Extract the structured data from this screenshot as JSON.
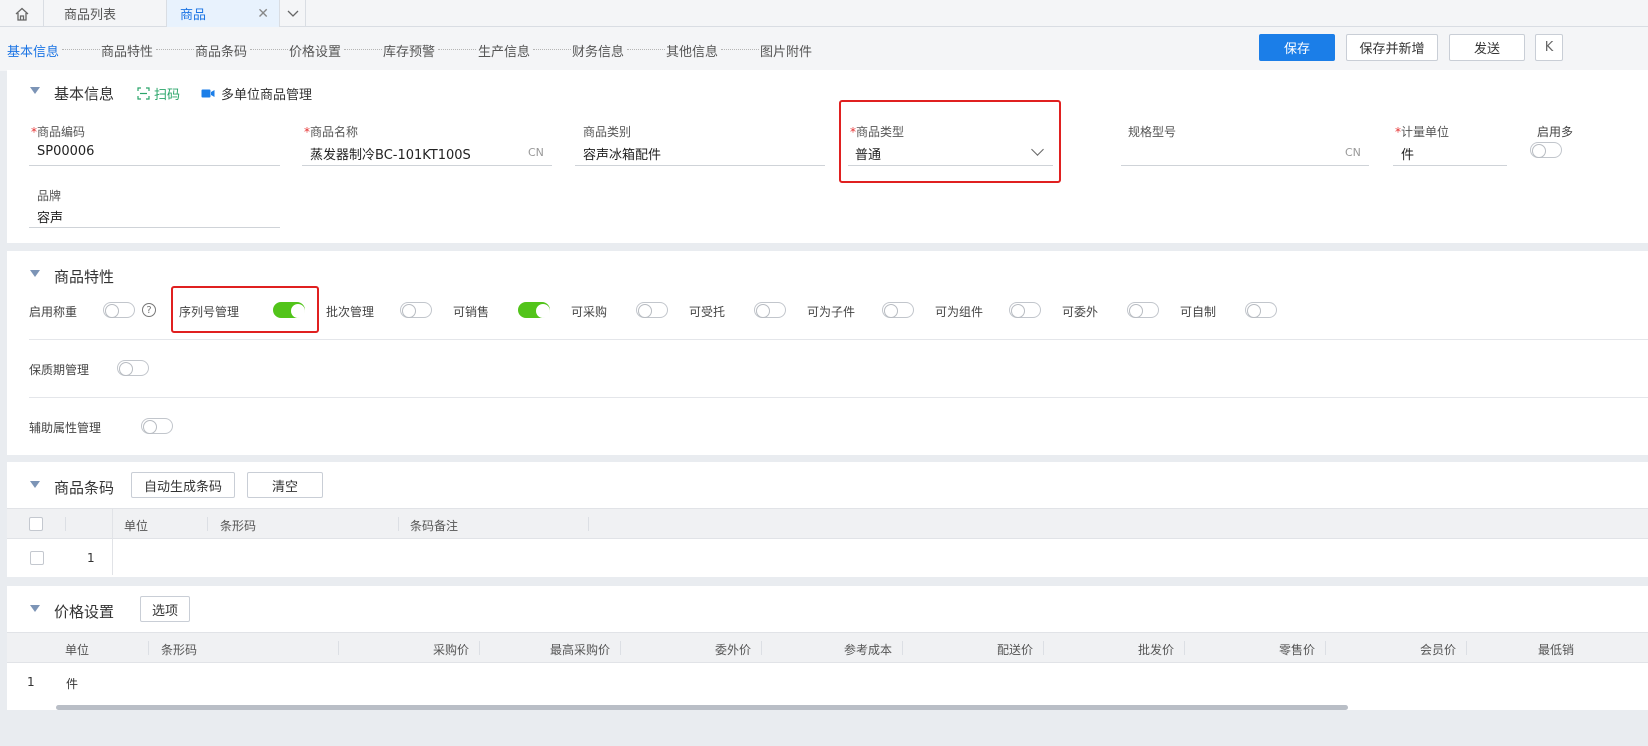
{
  "top_tabs": {
    "home_icon": "home-icon",
    "tabs": [
      {
        "label": "商品列表"
      },
      {
        "label": "商品"
      }
    ],
    "close_icon": "close-icon",
    "more_icon": "chevron-down-icon"
  },
  "anchors": [
    "基本信息",
    "商品特性",
    "商品条码",
    "价格设置",
    "库存预警",
    "生产信息",
    "财务信息",
    "其他信息",
    "图片附件"
  ],
  "toolbar": {
    "save": "保存",
    "save_and_new": "保存并新增",
    "send": "发送",
    "collapse": "K"
  },
  "basic_info": {
    "title": "基本信息",
    "scan_label": "扫码",
    "multi_unit_label": "多单位商品管理",
    "fields": {
      "code": {
        "label": "商品编码",
        "value": "SP00006",
        "required": "*"
      },
      "name": {
        "label": "商品名称",
        "value": "蒸发器制冷BC-101KT100S",
        "suffix": "CN",
        "required": "*"
      },
      "category": {
        "label": "商品类别",
        "value": "容声冰箱配件"
      },
      "type": {
        "label": "商品类型",
        "value": "普通",
        "required": "*"
      },
      "spec": {
        "label": "规格型号",
        "value": "",
        "suffix": "CN"
      },
      "unit": {
        "label": "计量单位",
        "value": "件",
        "required": "*"
      },
      "multi_unit": {
        "label": "启用多"
      },
      "brand": {
        "label": "品牌",
        "value": "容声"
      }
    }
  },
  "features": {
    "title": "商品特性",
    "items": [
      {
        "label": "启用称重",
        "on": false
      },
      {
        "label": "序列号管理",
        "on": true
      },
      {
        "label": "批次管理",
        "on": false
      },
      {
        "label": "可销售",
        "on": true
      },
      {
        "label": "可采购",
        "on": false
      },
      {
        "label": "可受托",
        "on": false
      },
      {
        "label": "可为子件",
        "on": false
      },
      {
        "label": "可为组件",
        "on": false
      },
      {
        "label": "可委外",
        "on": false
      },
      {
        "label": "可自制",
        "on": false
      }
    ],
    "help_icon": "?",
    "shelf_life": {
      "label": "保质期管理",
      "on": false
    },
    "aux_attr": {
      "label": "辅助属性管理",
      "on": false
    }
  },
  "barcode": {
    "title": "商品条码",
    "auto_btn": "自动生成条码",
    "clear_btn": "清空",
    "columns": [
      "单位",
      "条形码",
      "条码备注"
    ],
    "rows": [
      {
        "index": "1"
      }
    ]
  },
  "price": {
    "title": "价格设置",
    "option_btn": "选项",
    "columns": [
      "单位",
      "条形码",
      "采购价",
      "最高采购价",
      "委外价",
      "参考成本",
      "配送价",
      "批发价",
      "零售价",
      "会员价",
      "最低销"
    ],
    "rows": [
      {
        "index": "1",
        "unit": "件"
      }
    ]
  },
  "colors": {
    "accent": "#1b7ee8",
    "toggle_on": "#52c41a",
    "highlight": "#e02020"
  }
}
